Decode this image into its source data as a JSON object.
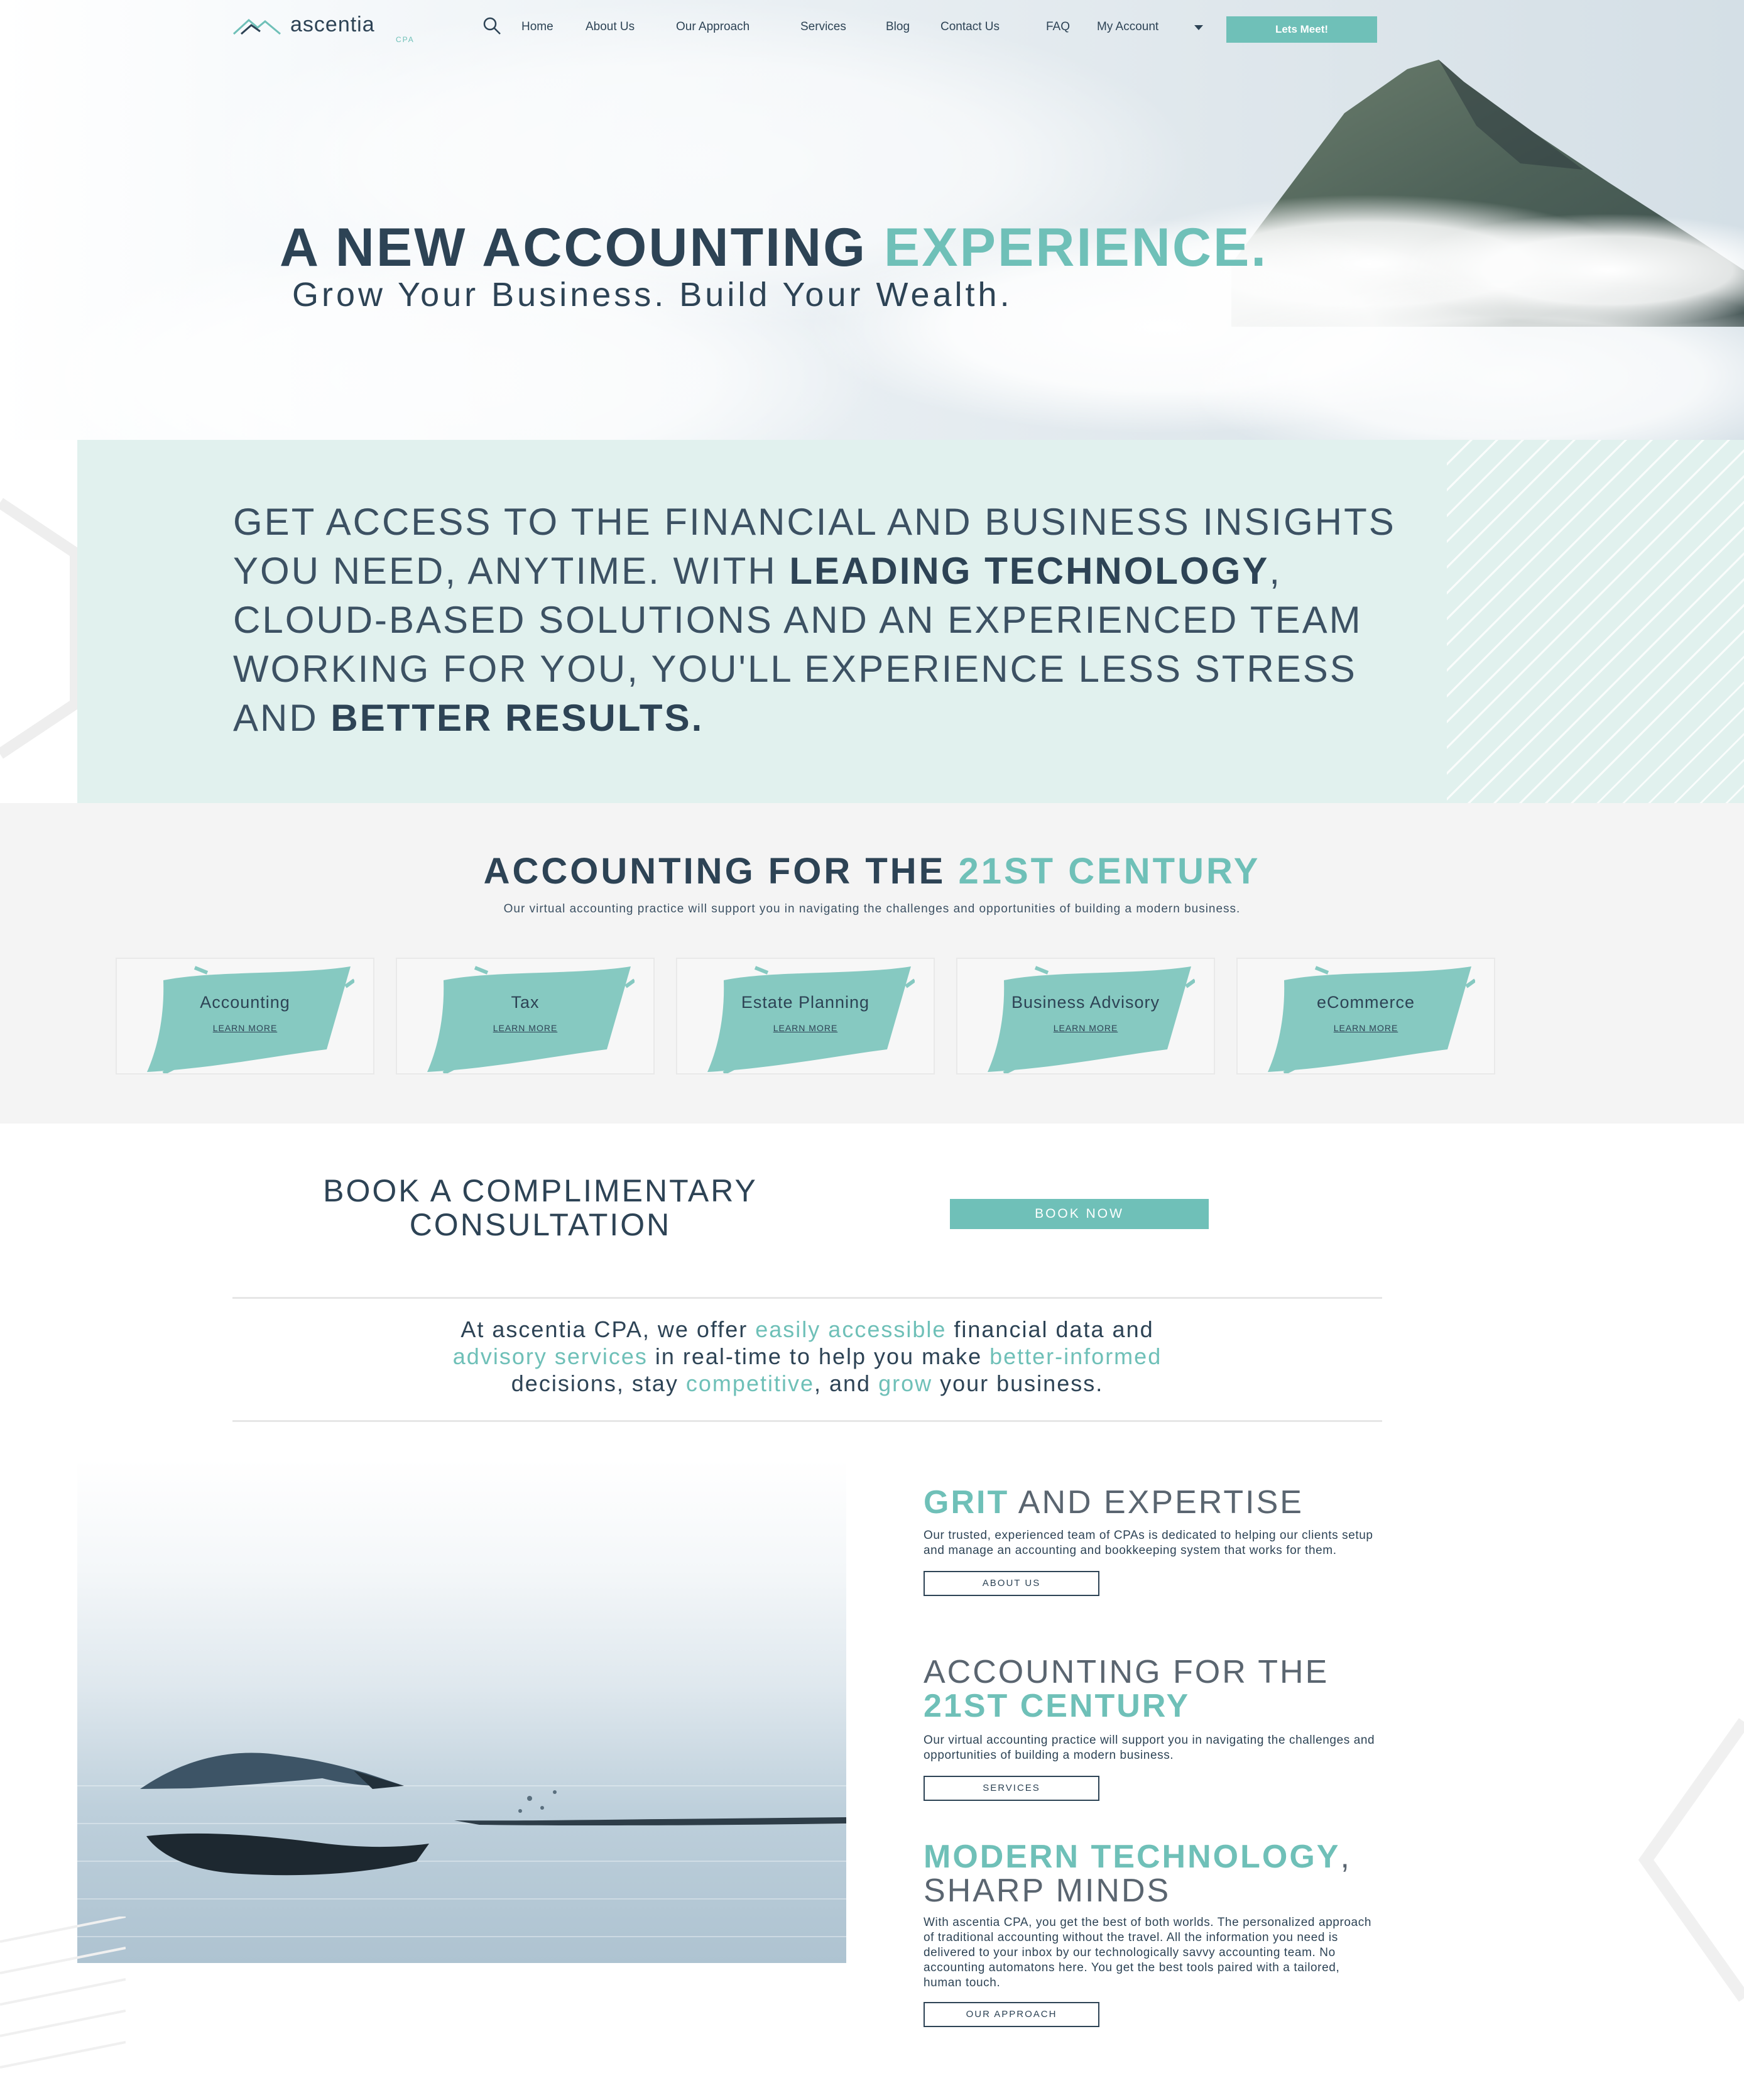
{
  "brand": {
    "name": "ascentia",
    "sub": "CPA",
    "accent": "#6fc0b8",
    "dark": "#2d4355",
    "mint": "#e1f1ee"
  },
  "nav": {
    "items": [
      "Home",
      "About Us",
      "Our Approach",
      "Services",
      "Blog",
      "Contact Us",
      "FAQ",
      "My Account"
    ],
    "cta": "Lets Meet!"
  },
  "hero": {
    "title_main": "A NEW ACCOUNTING",
    "title_accent": "EXPERIENCE.",
    "subtitle": "Grow Your Business. Build Your Wealth."
  },
  "insights": {
    "p1": "Get access to the financial and business insights you need, anytime. With ",
    "b1": "leading technology",
    "p2": ", cloud-based solutions and an experienced team working for you, you'll experience less stress and ",
    "b2": "better results."
  },
  "services": {
    "title_main": "ACCOUNTING FOR THE",
    "title_accent": "21ST CENTURY",
    "subtitle": "Our virtual accounting practice will support you in navigating the challenges and opportunities of building a modern business.",
    "link_label": "LEARN MORE",
    "cards": [
      "Accounting",
      "Tax",
      "Estate Planning",
      "Business Advisory",
      "eCommerce"
    ]
  },
  "book": {
    "line1": "BOOK A COMPLIMENTARY",
    "line2": "CONSULTATION",
    "button": "BOOK NOW"
  },
  "offer": {
    "t1": "At ascentia CPA, we offer ",
    "a1": "easily accessible",
    "t2": " financial data and ",
    "a2": "advisory services",
    "t3": " in real-time to help you make ",
    "a3": "better-informed",
    "t4": " decisions, stay ",
    "a4": "competitive",
    "t5": ", and ",
    "a5": "grow",
    "t6": " your business."
  },
  "features": {
    "grit": {
      "accent": "GRIT",
      "rest": " AND EXPERTISE",
      "text": "Our trusted, experienced team of CPAs is dedicated to helping our clients setup and manage an accounting and bookkeeping system that works for them.",
      "button": "ABOUT US"
    },
    "century": {
      "line1": "ACCOUNTING FOR THE",
      "accent": "21ST CENTURY",
      "text": "Our virtual accounting practice will support you in navigating the challenges and opportunities of building a modern business.",
      "button": "SERVICES"
    },
    "tech": {
      "accent": "MODERN TECHNOLOGY",
      "comma": ",",
      "line2": "SHARP MINDS",
      "text": "With ascentia CPA, you get the best of both worlds. The personalized approach of traditional accounting without the travel. All the information you need is delivered to your inbox by our technologically savvy accounting team. No accounting automatons here. You get the best tools paired with a tailored, human touch.",
      "button": "OUR APPROACH"
    }
  }
}
